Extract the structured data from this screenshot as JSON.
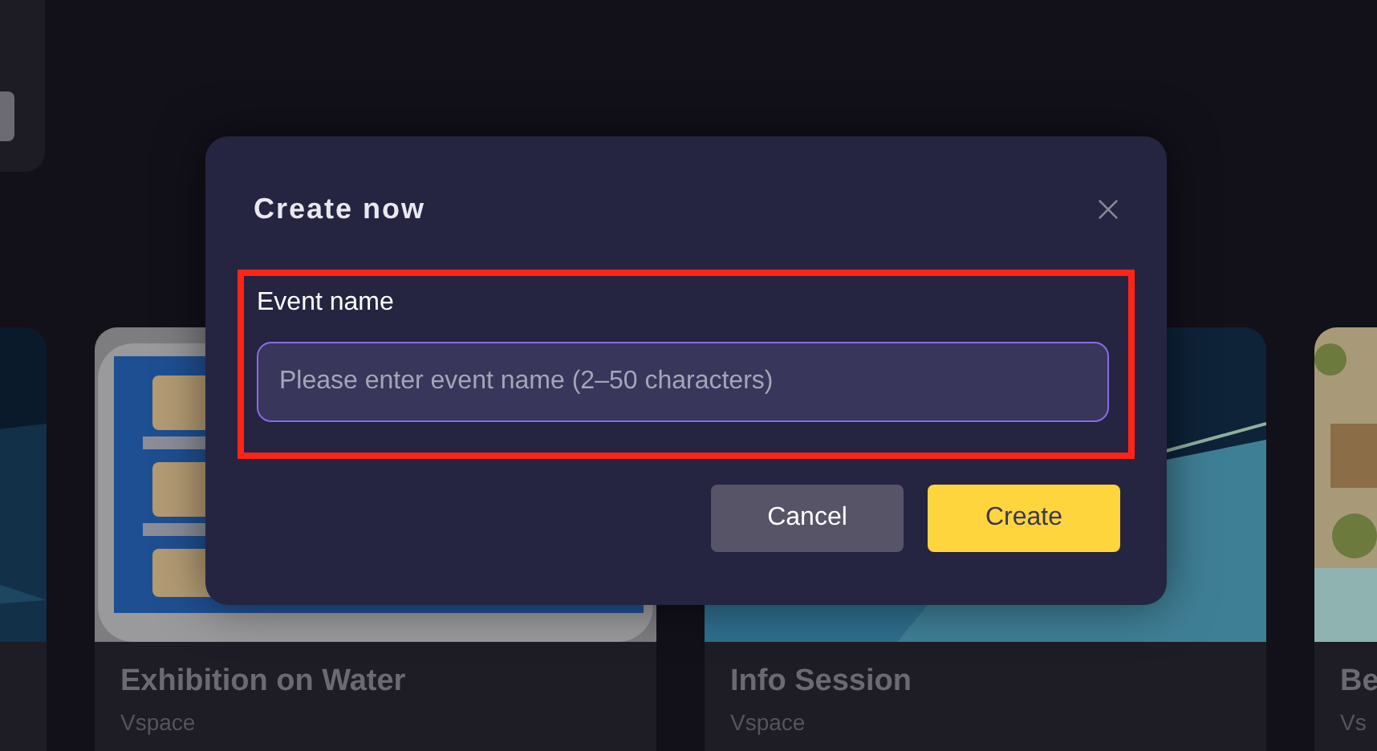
{
  "cards": [
    {
      "kind": "picture"
    },
    {
      "kind": "picture",
      "title": "Exhibition on Water",
      "subtitle": "Vspace"
    },
    {
      "kind": "picture",
      "title": "Info Session",
      "subtitle": "Vspace"
    },
    {
      "kind": "picture",
      "title": "Be",
      "subtitle": "Vs"
    }
  ],
  "dialog": {
    "title": "Create now",
    "field": {
      "label": "Event name",
      "placeholder": "Please enter event name (2–50 characters)",
      "highlighted": true
    },
    "buttons": [
      {
        "label": "Cancel",
        "kind": "secondary"
      },
      {
        "label": "Create",
        "kind": "primary"
      }
    ]
  }
}
